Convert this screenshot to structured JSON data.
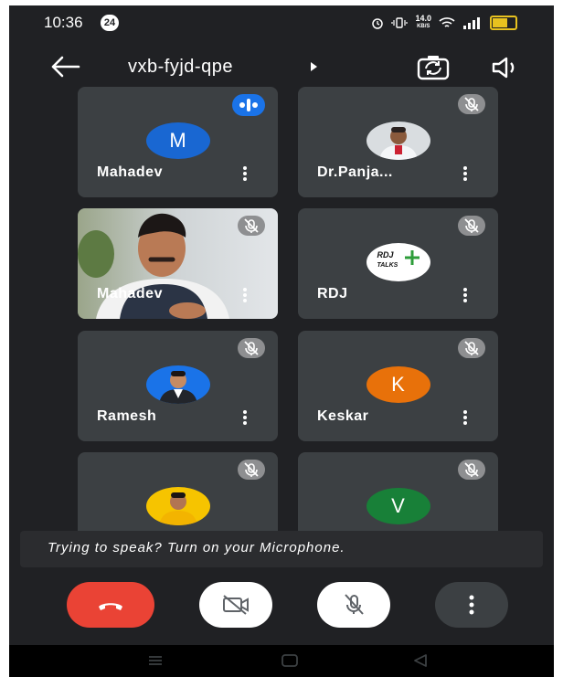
{
  "status_bar": {
    "time": "10:36",
    "notification_count": "24",
    "net_speed_value": "14.0",
    "net_speed_unit": "KB/S",
    "icons": [
      "alarm-icon",
      "vibrate-icon",
      "wifi-icon",
      "signal-icon",
      "battery-icon"
    ]
  },
  "top_bar": {
    "meeting_code": "vxb-fyjd-qpe",
    "icons": [
      "back-arrow-icon",
      "switch-camera-icon",
      "speaker-icon"
    ]
  },
  "participants": [
    {
      "name": "Mahadev",
      "type": "initial",
      "initial": "M",
      "avatar_color": "#1967d2",
      "status": "speaking"
    },
    {
      "name": "Dr.Panja...",
      "type": "photo",
      "status": "muted"
    },
    {
      "name": "Mahadev",
      "type": "video",
      "status": "muted"
    },
    {
      "name": "RDJ",
      "type": "logo",
      "logo_line1": "RDJ",
      "logo_line2": "TALKS",
      "status": "muted"
    },
    {
      "name": "Ramesh",
      "type": "photo",
      "status": "muted"
    },
    {
      "name": "Keskar",
      "type": "initial",
      "initial": "K",
      "avatar_color": "#e8710a",
      "status": "muted"
    },
    {
      "name": "",
      "type": "photo",
      "status": "muted"
    },
    {
      "name": "",
      "type": "initial",
      "initial": "V",
      "avatar_color": "#188038",
      "status": "muted"
    }
  ],
  "banner": {
    "text": "Trying to speak? Turn on your Microphone."
  },
  "controls": {
    "hangup_color": "#ea4335",
    "icons": [
      "end-call-icon",
      "camera-off-icon",
      "mic-off-icon",
      "more-options-icon"
    ]
  },
  "nav_bar": {
    "icons": [
      "recents-icon",
      "home-icon",
      "back-icon"
    ]
  }
}
